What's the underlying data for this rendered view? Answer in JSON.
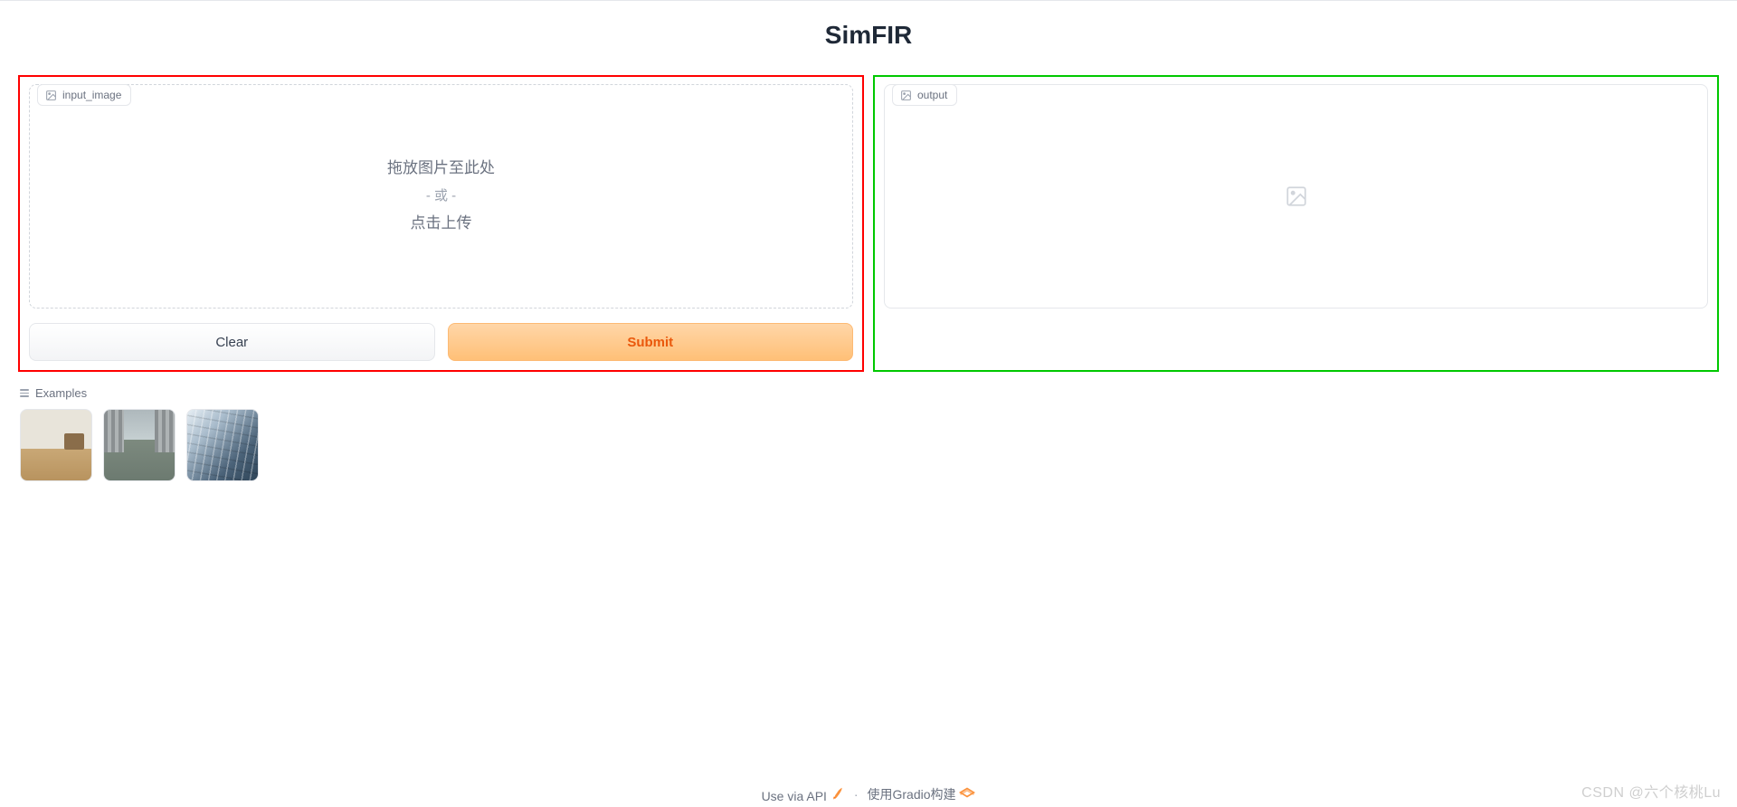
{
  "title": "SimFIR",
  "input_panel": {
    "label": "input_image",
    "drop_line1": "拖放图片至此处",
    "drop_or": "- 或 -",
    "drop_line2": "点击上传"
  },
  "output_panel": {
    "label": "output"
  },
  "buttons": {
    "clear": "Clear",
    "submit": "Submit"
  },
  "examples": {
    "label": "Examples",
    "count": 3
  },
  "footer": {
    "api_text": "Use via API",
    "built_text": "使用Gradio构建"
  },
  "watermark": "CSDN @六个核桃Lu",
  "colors": {
    "highlight_red": "#ff0000",
    "highlight_green": "#00c800",
    "accent_orange": "#ea580c"
  }
}
